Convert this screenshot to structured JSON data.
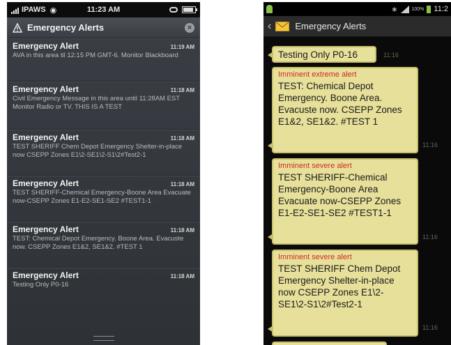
{
  "ios": {
    "status": {
      "carrier": "IPAWS",
      "time": "11:23 AM"
    },
    "header": {
      "title": "Emergency Alerts"
    },
    "alerts": [
      {
        "name": "Emergency Alert",
        "time": "11:19 AM",
        "body": "AVA in this area til 12:15 PM GMT-6. Monitor Blackboard"
      },
      {
        "name": "Emergency Alert",
        "time": "11:18 AM",
        "body": "Civil Emergency Message in this area until 11:28AM EST Monitor Radio or TV. THIS IS A TEST"
      },
      {
        "name": "Emergency Alert",
        "time": "11:18 AM",
        "body": "TEST SHERIFF Chem Depot Emergency Shelter-in-place now CSEPP Zones E1\\2-SE1\\2-S1\\2#Test2-1"
      },
      {
        "name": "Emergency Alert",
        "time": "11:18 AM",
        "body": "TEST SHERIFF-Chemical Emergency-Boone Area Evacuate now-CSEPP Zones E1-E2-SE1-SE2 #TEST1-1"
      },
      {
        "name": "Emergency Alert",
        "time": "11:18 AM",
        "body": "TEST: Chemical Depot Emergency. Boone Area. Evacuste now. CSEPP Zones E1&2, SE1&2. #TEST 1"
      },
      {
        "name": "Emergency Alert",
        "time": "11:18 AM",
        "body": "Testing Only P0-16"
      }
    ]
  },
  "android": {
    "status": {
      "battery": "100%",
      "time": "11:2"
    },
    "bar": {
      "title": "Emergency Alerts"
    },
    "messages": [
      {
        "category": "",
        "text": "Testing Only P0-16",
        "time": "11:16"
      },
      {
        "category": "Imminent extreme alert",
        "text": "TEST: Chemical Depot Emergency. Boone Area. Evacuste now. CSEPP Zones E1&2, SE1&2. #TEST 1",
        "time": "11:16"
      },
      {
        "category": "Imminent severe alert",
        "text": "TEST SHERIFF-Chemical Emergency-Boone Area Evacuate now-CSEPP Zones E1-E2-SE1-SE2 #TEST1-1",
        "time": "11:16"
      },
      {
        "category": "Imminent severe alert",
        "text": "TEST SHERIFF Chem Depot Emergency Shelter-in-place now CSEPP Zones E1\\2-SE1\\2-S1\\2#Test2-1",
        "time": "11:16"
      }
    ]
  },
  "colors": {
    "bubble": "#e7e09a",
    "category_red": "#d22a1f",
    "ios_background": "#3b3f45"
  }
}
